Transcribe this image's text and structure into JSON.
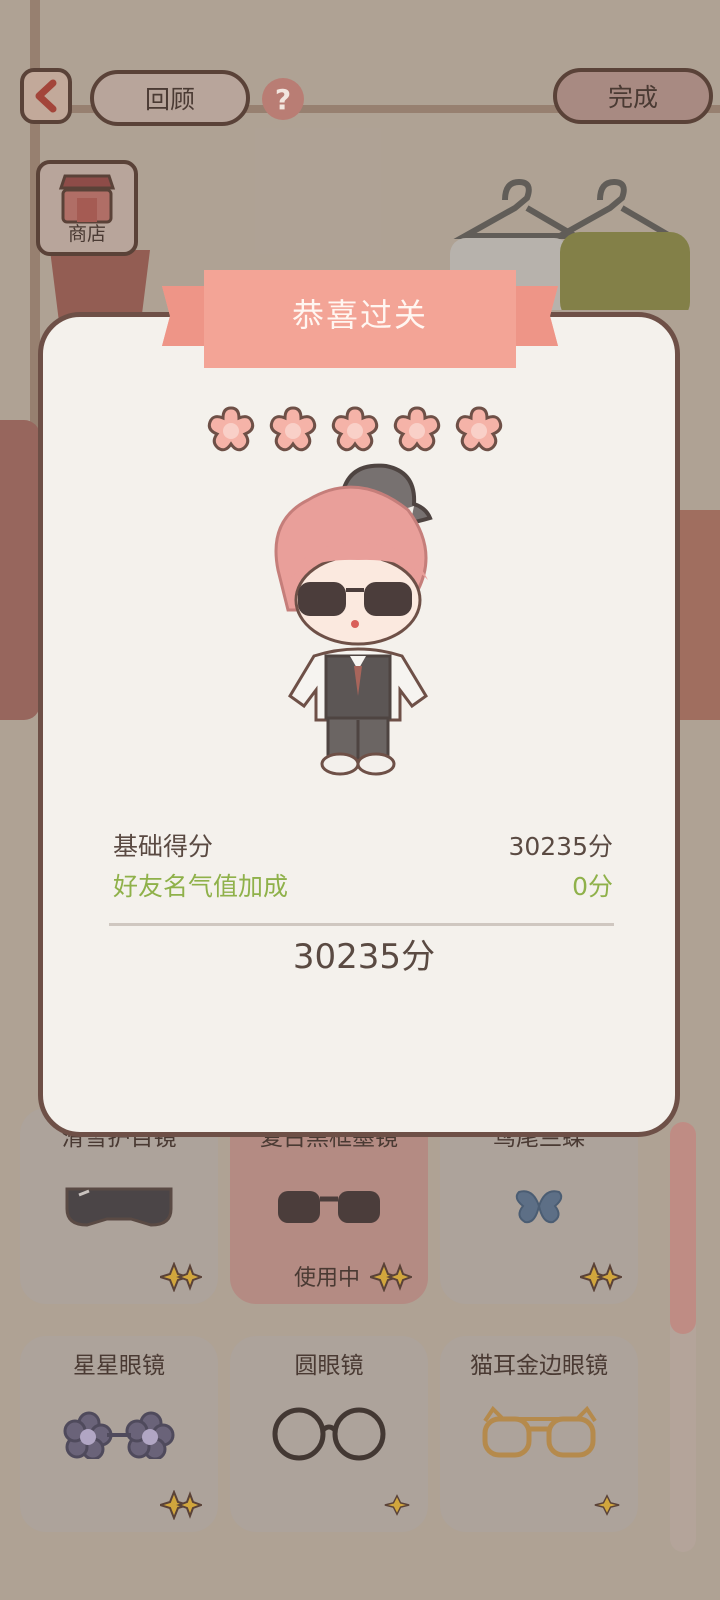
{
  "header": {
    "review_label": "回顾",
    "done_label": "完成",
    "help_label": "?",
    "shop_label": "商店"
  },
  "modal": {
    "title": "恭喜过关",
    "stars": 5,
    "base_label": "基础得分",
    "base_value": "30235分",
    "bonus_label": "好友名气值加成",
    "bonus_value": "0分",
    "total": "30235分"
  },
  "items": [
    {
      "name": "滑雪护目镜",
      "icon": "ski-goggles-icon",
      "status": ""
    },
    {
      "name": "复古黑框墨镜",
      "icon": "black-sunglasses-icon",
      "status": "使用中"
    },
    {
      "name": "鸢尾兰蝶",
      "icon": "butterfly-icon",
      "status": ""
    },
    {
      "name": "星星眼镜",
      "icon": "flower-glasses-icon",
      "status": ""
    },
    {
      "name": "圆眼镜",
      "icon": "round-glasses-icon",
      "status": ""
    },
    {
      "name": "猫耳金边眼镜",
      "icon": "cat-ear-glasses-icon",
      "status": ""
    }
  ],
  "colors": {
    "accent": "#f3a496",
    "bonus_green": "#8fb14a",
    "outline": "#6e5047"
  }
}
